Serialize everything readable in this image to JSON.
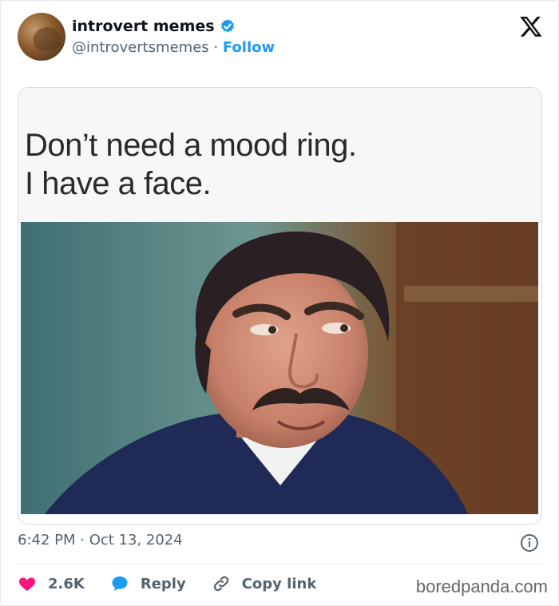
{
  "author": {
    "name": "introvert memes",
    "handle": "@introvertsmemes",
    "separator": "·",
    "follow_label": "Follow",
    "verified_color": "#1d9bf0"
  },
  "post": {
    "caption_line1": "Don’t need a mood ring.",
    "caption_line2": "I have a face."
  },
  "meta": {
    "timestamp": "6:42 PM · Oct 13, 2024"
  },
  "actions": {
    "likes": "2.6K",
    "reply_label": "Reply",
    "copy_link_label": "Copy link",
    "like_color": "#f91880",
    "reply_color": "#1d9bf0"
  },
  "watermark": "boredpanda.com",
  "icons": [
    "x-logo-icon",
    "verified-badge-icon",
    "info-icon",
    "heart-icon",
    "reply-bubble-icon",
    "link-icon"
  ]
}
